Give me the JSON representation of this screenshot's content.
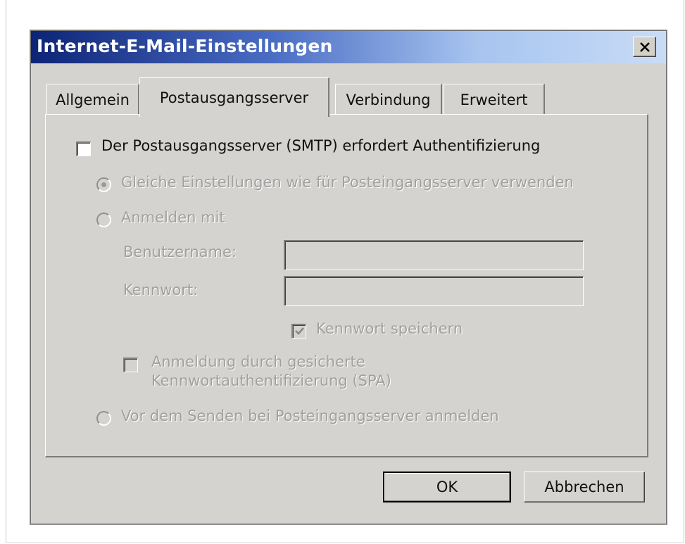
{
  "dialog": {
    "title": "Internet-E-Mail-Einstellungen",
    "close_label": "✕"
  },
  "tabs": [
    {
      "label": "Allgemein",
      "active": false
    },
    {
      "label": "Postausgangsserver",
      "active": true
    },
    {
      "label": "Verbindung",
      "active": false
    },
    {
      "label": "Erweitert",
      "active": false
    }
  ],
  "smtp": {
    "auth_required_label": "Der Postausgangsserver (SMTP) erfordert Authentifizierung",
    "auth_required_checked": false,
    "option_same_settings": "Gleiche Einstellungen wie für Posteingangsserver verwenden",
    "option_login_with": "Anmelden mit",
    "option_pop_before_smtp": "Vor dem Senden bei Posteingangsserver anmelden",
    "selected_option": "option_same_settings",
    "username_label": "Benutzername:",
    "username_value": "",
    "password_label": "Kennwort:",
    "password_value": "",
    "save_password_label": "Kennwort speichern",
    "save_password_checked": true,
    "spa_label_line1": "Anmeldung durch gesicherte",
    "spa_label_line2": "Kennwortauthentifizierung (SPA)",
    "spa_checked": false
  },
  "buttons": {
    "ok": "OK",
    "cancel": "Abbrechen"
  },
  "colors": {
    "title_gradient_start": "#0d2476",
    "title_gradient_end": "#c9dcf6",
    "dialog_face": "#d5d3cf",
    "disabled_text": "#a0a0a0"
  }
}
